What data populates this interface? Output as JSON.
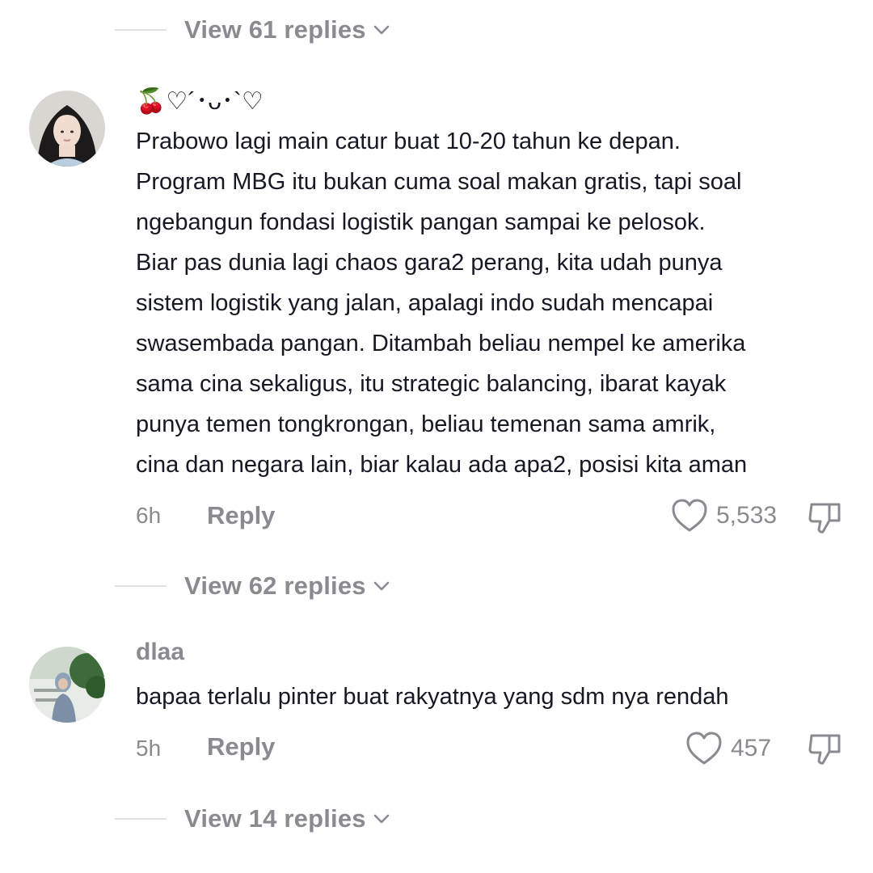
{
  "threads": [
    {
      "view_replies_label": "View 61 replies"
    },
    {
      "view_replies_label": "View 62 replies"
    },
    {
      "view_replies_label": "View 14 replies"
    }
  ],
  "comments": [
    {
      "username": "🍒♡´･ᴗ･`♡",
      "text": "Prabowo lagi main catur buat 10-20 tahun ke depan.\nProgram MBG itu bukan cuma soal makan gratis, tapi soal\nngebangun fondasi logistik pangan sampai ke pelosok.\nBiar pas dunia lagi chaos gara2 perang, kita udah punya\nsistem logistik yang jalan, apalagi indo sudah mencapai\nswasembada pangan. Ditambah beliau nempel ke amerika\nsama cina sekaligus, itu strategic balancing, ibarat kayak\npunya temen tongkrongan, beliau temenan sama amrik,\ncina dan negara lain, biar kalau ada apa2, posisi kita aman",
      "time": "6h",
      "reply_label": "Reply",
      "likes": "5,533",
      "avatar_icon": "avatar-photo"
    },
    {
      "username": "dlaa",
      "text": "bapaa terlalu pinter buat rakyatnya yang sdm nya rendah",
      "time": "5h",
      "reply_label": "Reply",
      "likes": "457",
      "avatar_icon": "avatar-photo"
    }
  ],
  "icons": {
    "like": "heart-outline-icon",
    "dislike": "thumbs-down-icon",
    "expand": "chevron-down-icon"
  },
  "colors": {
    "text": "#161823",
    "muted": "#8a8b91",
    "divider": "#e3e3e4",
    "background": "#ffffff"
  }
}
